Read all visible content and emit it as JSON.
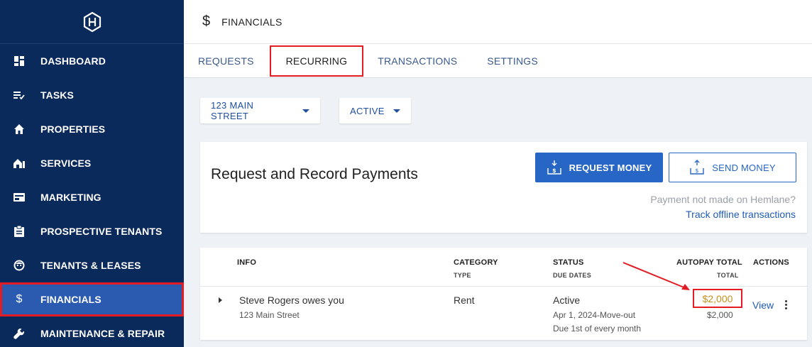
{
  "sidebar": {
    "items": [
      {
        "label": "DASHBOARD",
        "icon": "dashboard-icon"
      },
      {
        "label": "TASKS",
        "icon": "tasks-icon"
      },
      {
        "label": "PROPERTIES",
        "icon": "home-icon"
      },
      {
        "label": "SERVICES",
        "icon": "services-icon"
      },
      {
        "label": "MARKETING",
        "icon": "marketing-icon"
      },
      {
        "label": "PROSPECTIVE TENANTS",
        "icon": "clipboard-icon"
      },
      {
        "label": "TENANTS & LEASES",
        "icon": "face-icon"
      },
      {
        "label": "FINANCIALS",
        "icon": "dollar-icon"
      },
      {
        "label": "MAINTENANCE & REPAIR",
        "icon": "wrench-icon"
      }
    ]
  },
  "header": {
    "icon": "$",
    "title": "FINANCIALS"
  },
  "tabs": [
    {
      "label": "REQUESTS"
    },
    {
      "label": "RECURRING"
    },
    {
      "label": "TRANSACTIONS"
    },
    {
      "label": "SETTINGS"
    }
  ],
  "filters": {
    "property": "123 MAIN STREET",
    "status": "ACTIVE"
  },
  "payments": {
    "title": "Request and Record Payments",
    "request_button": "REQUEST MONEY",
    "send_button": "SEND MONEY",
    "offline_note": "Payment not made on Hemlane?",
    "offline_link": "Track offline transactions"
  },
  "table": {
    "headers": {
      "info": "INFO",
      "category": "CATEGORY",
      "category_sub": "TYPE",
      "status": "STATUS",
      "status_sub": "DUE DATES",
      "autopay": "AUTOPAY TOTAL",
      "autopay_sub": "TOTAL",
      "actions": "ACTIONS"
    },
    "row": {
      "info": "Steve Rogers owes you",
      "address": "123 Main Street",
      "category": "Rent",
      "status": "Active",
      "due_range": "Apr 1, 2024-Move-out",
      "due_rule": "Due 1st of every month",
      "autopay_total": "$2,000",
      "total": "$2,000",
      "view": "View"
    }
  },
  "colors": {
    "sidebar": "#0b2a5c",
    "accent": "#2766c4",
    "highlight": "#e31b23",
    "amount": "#c8901a"
  }
}
